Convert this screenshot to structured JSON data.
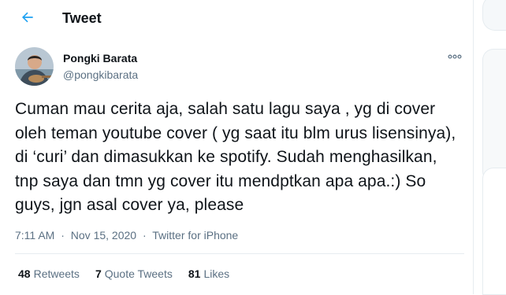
{
  "header": {
    "title": "Tweet",
    "back_icon": "arrow-left-icon"
  },
  "author": {
    "display_name": "Pongki Barata",
    "handle": "@pongkibarata"
  },
  "more_icon": "more-horizontal-icon",
  "tweet": {
    "text": "Cuman mau cerita aja, salah satu lagu saya , yg di cover oleh teman youtube cover ( yg saat itu blm urus lisensinya), di ‘curi’ dan dimasukkan ke spotify. Sudah menghasilkan, tnp saya dan tmn yg cover itu mendptkan apa apa.:) So guys, jgn asal cover ya, please",
    "time": "7:11 AM",
    "separator": "·",
    "date": "Nov 15, 2020",
    "source": "Twitter for iPhone"
  },
  "stats": {
    "retweets_count": "48",
    "retweets_label": "Retweets",
    "quotes_count": "7",
    "quotes_label": "Quote Tweets",
    "likes_count": "81",
    "likes_label": "Likes"
  },
  "colors": {
    "accent": "#1da1f2",
    "secondary_text": "#5b7083",
    "border": "#e6ecf0"
  }
}
